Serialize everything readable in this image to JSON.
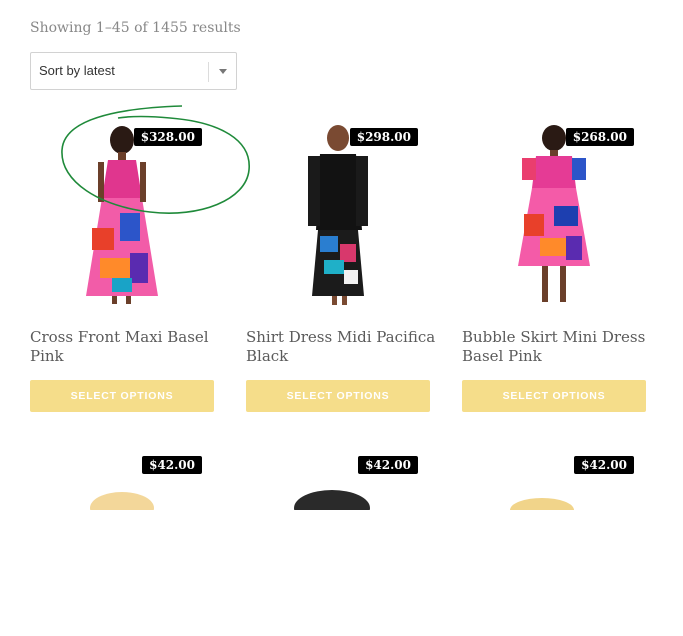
{
  "results": {
    "text": "Showing 1–45 of 1455 results"
  },
  "sort": {
    "selected": "Sort by latest",
    "icon": "chevron-down-icon"
  },
  "products": [
    {
      "price": "$328.00",
      "title": "Cross Front Maxi Basel Pink",
      "button": "SELECT OPTIONS"
    },
    {
      "price": "$298.00",
      "title": "Shirt Dress Midi Pacifica Black",
      "button": "SELECT OPTIONS"
    },
    {
      "price": "$268.00",
      "title": "Bubble Skirt Mini Dress Basel Pink",
      "button": "SELECT OPTIONS"
    },
    {
      "price": "$42.00"
    },
    {
      "price": "$42.00"
    },
    {
      "price": "$42.00"
    }
  ],
  "colors": {
    "price_badge": "#000000",
    "button_bg": "#f5dd8a",
    "button_text": "#ffffff",
    "annotation": "#1f8a3a"
  }
}
